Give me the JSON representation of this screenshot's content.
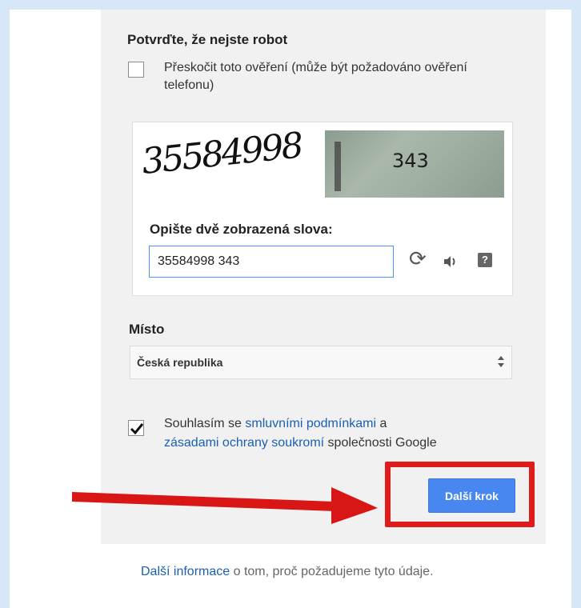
{
  "robot": {
    "title": "Potvrďte, že nejste robot",
    "skip_label": "Přeskočit toto ověření (může být požadováno ověření telefonu)",
    "skip_checked": false
  },
  "captcha": {
    "image1_text": "35584998",
    "image2_text": "343",
    "prompt": "Opište dvě zobrazená slova:",
    "input_value": "35584998 343",
    "refresh_icon": "refresh-icon",
    "audio_icon": "audio-icon",
    "help_icon": "help-icon",
    "help_glyph": "?"
  },
  "location": {
    "label": "Místo",
    "selected": "Česká republika"
  },
  "terms": {
    "checked": true,
    "text_prefix": "Souhlasím se ",
    "link1": "smluvními podmínkami",
    "text_middle": " a",
    "link2": "zásadami ochrany soukromí",
    "text_suffix": " společnosti Google"
  },
  "next_button_label": "Další krok",
  "footer": {
    "link": "Další informace",
    "text": " o tom, proč požadujeme tyto údaje."
  },
  "colors": {
    "accent": "#4887ef",
    "link": "#1a5fb4",
    "highlight": "#e01b1b",
    "frame": "#d6e8f7"
  }
}
